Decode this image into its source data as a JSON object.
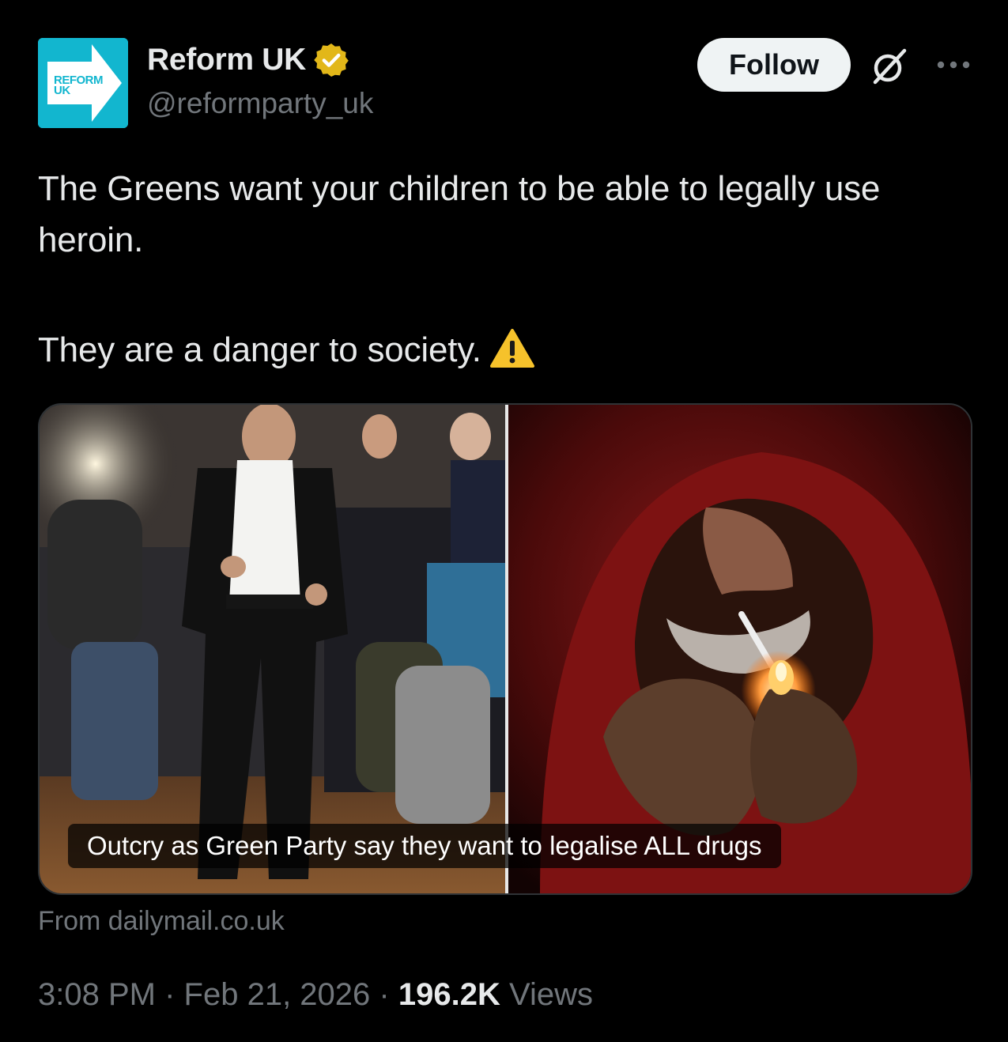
{
  "author": {
    "display_name": "Reform UK",
    "handle": "@reformparty_uk",
    "avatar_text_line1": "REFORM",
    "avatar_text_line2": "UK",
    "avatar_color": "#12b6cf",
    "verified": true,
    "verified_badge_color": "#e2b719"
  },
  "actions": {
    "follow_label": "Follow",
    "grok_icon": "grok-icon",
    "more_icon": "more-icon"
  },
  "tweet": {
    "text_line1": "The Greens want your children to be able to legally use heroin.",
    "text_line2": "They are a danger to society.",
    "emoji": "warning-icon"
  },
  "link_card": {
    "caption": "Outcry as Green Party say they want to legalise ALL drugs",
    "source": "From dailymail.co.uk"
  },
  "meta": {
    "time": "3:08 PM",
    "separator": "·",
    "date": "Feb 21, 2026",
    "views_count": "196.2K",
    "views_label": "Views"
  }
}
